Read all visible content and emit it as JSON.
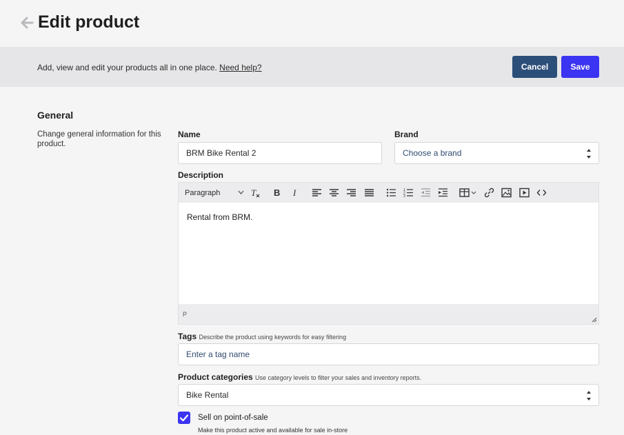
{
  "header": {
    "title": "Edit product",
    "back_icon": "arrow-left-icon"
  },
  "banner": {
    "text": "Add, view and edit your products all in one place.",
    "link": "Need help?",
    "cancel_label": "Cancel",
    "save_label": "Save"
  },
  "general": {
    "title": "General",
    "description": "Change general information for this product.",
    "name_label": "Name",
    "name_value": "BRM Bike Rental 2",
    "brand_label": "Brand",
    "brand_placeholder": "Choose a brand",
    "description_label": "Description",
    "editor": {
      "block_format": "Paragraph",
      "content": "Rental from BRM.",
      "status_path": "P",
      "toolbar_icons": [
        "clear-format-icon",
        "bold-icon",
        "italic-icon",
        "align-left-icon",
        "align-center-icon",
        "align-right-icon",
        "align-justify-icon",
        "bullet-list-icon",
        "numbered-list-icon",
        "outdent-icon",
        "indent-icon",
        "table-icon",
        "link-icon",
        "image-icon",
        "media-icon",
        "code-icon"
      ]
    },
    "tags_label": "Tags",
    "tags_hint": "Describe the product using keywords for easy filtering",
    "tags_placeholder": "Enter a tag name",
    "categories_label": "Product categories",
    "categories_hint": "Use category levels to filter your sales and inventory reports.",
    "categories_value": "Bike Rental",
    "pos_label": "Sell on point-of-sale",
    "pos_desc": "Make this product active and available for sale in-store",
    "pos_checked": true
  },
  "colors": {
    "accent": "#3b34f2",
    "cancel": "#2c4f79"
  }
}
